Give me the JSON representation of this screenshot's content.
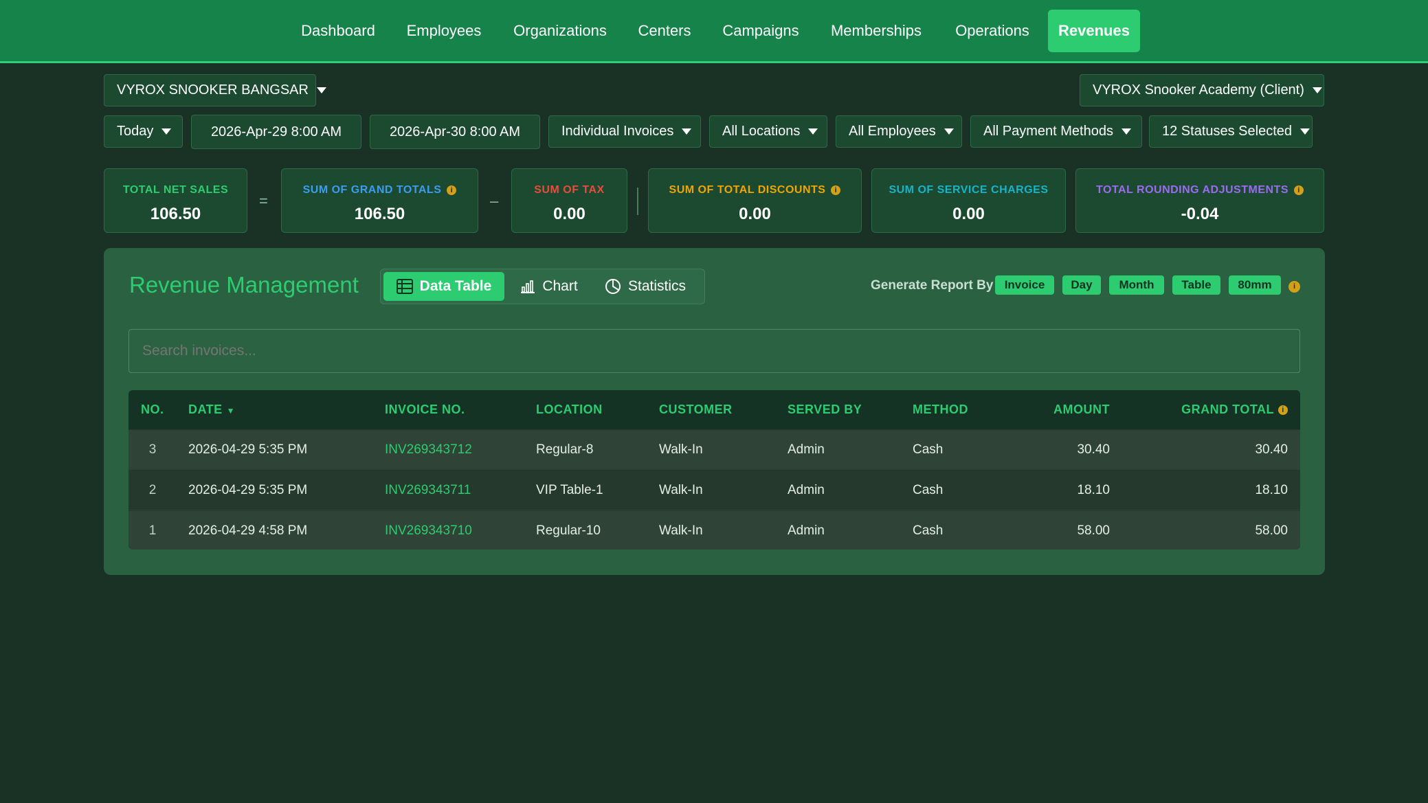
{
  "nav": {
    "items": [
      "Dashboard",
      "Employees",
      "Organizations",
      "Centers",
      "Campaigns",
      "Memberships",
      "Operations",
      "Revenues"
    ],
    "active": "Revenues"
  },
  "header": {
    "branch": "VYROX SNOOKER BANGSAR",
    "client": "VYROX Snooker Academy (Client)"
  },
  "filters": {
    "period": "Today",
    "start": "2026-Apr-29 8:00 AM",
    "end": "2026-Apr-30 8:00 AM",
    "mode": "Individual Invoices",
    "locations": "All Locations",
    "employees": "All Employees",
    "payment_methods": "All Payment Methods",
    "statuses": "12 Statuses Selected"
  },
  "summary": {
    "net_sales": {
      "label": "TOTAL NET SALES",
      "value": "106.50",
      "color": "#2ecc71"
    },
    "grand_totals": {
      "label": "SUM OF GRAND TOTALS",
      "value": "106.50",
      "color": "#3b9cf0"
    },
    "tax": {
      "label": "SUM OF TAX",
      "value": "0.00",
      "color": "#e74c3c"
    },
    "discounts": {
      "label": "SUM OF TOTAL DISCOUNTS",
      "value": "0.00",
      "color": "#f0a500"
    },
    "service_charges": {
      "label": "SUM OF SERVICE CHARGES",
      "value": "0.00",
      "color": "#17b3c9"
    },
    "rounding": {
      "label": "TOTAL ROUNDING ADJUSTMENTS",
      "value": "-0.04",
      "color": "#9b6cf0"
    },
    "op_equals": "=",
    "op_minus": "–",
    "info_glyph": "i"
  },
  "panel": {
    "title": "Revenue Management",
    "views": [
      "Data Table",
      "Chart",
      "Statistics"
    ],
    "active_view": "Data Table",
    "report_label": "Generate Report By",
    "report_options": [
      "Invoice",
      "Day",
      "Month",
      "Table",
      "80mm"
    ],
    "search_placeholder": "Search invoices...",
    "sort_indicator": "▼"
  },
  "table": {
    "columns": [
      "NO.",
      "DATE",
      "INVOICE NO.",
      "LOCATION",
      "CUSTOMER",
      "SERVED BY",
      "METHOD",
      "AMOUNT",
      "GRAND TOTAL"
    ],
    "rows": [
      {
        "no": "3",
        "date": "2026-04-29 5:35 PM",
        "invoice": "INV269343712",
        "location": "Regular-8",
        "customer": "Walk-In",
        "served_by": "Admin",
        "method": "Cash",
        "amount": "30.40",
        "grand_total": "30.40"
      },
      {
        "no": "2",
        "date": "2026-04-29 5:35 PM",
        "invoice": "INV269343711",
        "location": "VIP Table-1",
        "customer": "Walk-In",
        "served_by": "Admin",
        "method": "Cash",
        "amount": "18.10",
        "grand_total": "18.10"
      },
      {
        "no": "1",
        "date": "2026-04-29 4:58 PM",
        "invoice": "INV269343710",
        "location": "Regular-10",
        "customer": "Walk-In",
        "served_by": "Admin",
        "method": "Cash",
        "amount": "58.00",
        "grand_total": "58.00"
      }
    ]
  },
  "colors": {
    "accent": "#2ecc71",
    "nav_bg": "#16834a",
    "page_bg": "#1a3226",
    "info": "#d4a017"
  }
}
